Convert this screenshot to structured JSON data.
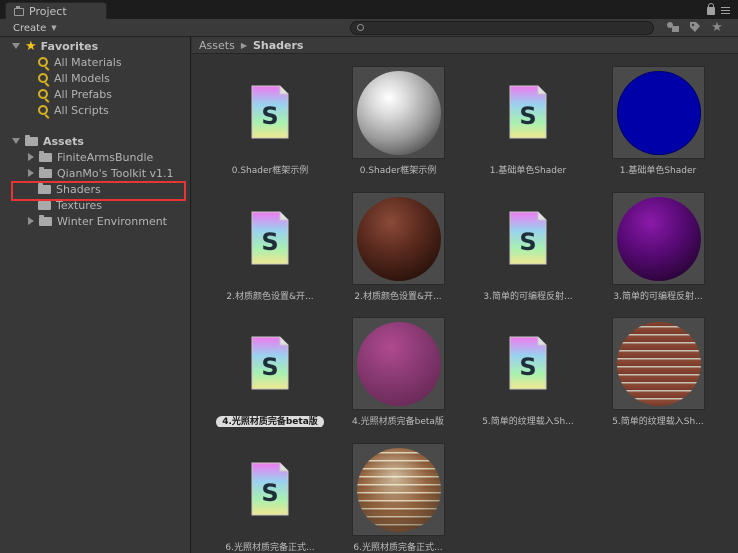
{
  "window": {
    "tab_title": "Project"
  },
  "toolbar": {
    "create_label": "Create",
    "search_placeholder": ""
  },
  "sidebar": {
    "favorites_label": "Favorites",
    "favorites": [
      "All Materials",
      "All Models",
      "All Prefabs",
      "All Scripts"
    ],
    "assets_label": "Assets",
    "folders": [
      "FiniteArmsBundle",
      "QianMo's Toolkit v1.1",
      "Shaders",
      "Textures",
      "Winter Environment"
    ],
    "selected_folder": "Shaders"
  },
  "breadcrumb": {
    "root": "Assets",
    "current": "Shaders"
  },
  "assets": [
    {
      "label": "0.Shader框架示例",
      "kind": "shader"
    },
    {
      "label": "0.Shader框架示例",
      "kind": "material",
      "preview": "white-gloss"
    },
    {
      "label": "1.基础单色Shader",
      "kind": "shader"
    },
    {
      "label": "1.基础单色Shader",
      "kind": "material",
      "preview": "blue-flat"
    },
    {
      "label": "2.材质颜色设置&开...",
      "kind": "shader"
    },
    {
      "label": "2.材质颜色设置&开...",
      "kind": "material",
      "preview": "brown-lit"
    },
    {
      "label": "3.简单的可编程反射...",
      "kind": "shader"
    },
    {
      "label": "3.简单的可编程反射...",
      "kind": "material",
      "preview": "purple-lit"
    },
    {
      "label": "4.光照材质完备beta版",
      "kind": "shader",
      "selected": true
    },
    {
      "label": "4.光照材质完备beta版",
      "kind": "material",
      "preview": "pink-lit"
    },
    {
      "label": "5.简单的纹理载入Sh...",
      "kind": "shader"
    },
    {
      "label": "5.简单的纹理载入Sh...",
      "kind": "material",
      "preview": "brick"
    },
    {
      "label": "6.光照材质完备正式...",
      "kind": "shader"
    },
    {
      "label": "6.光照材质完备正式...",
      "kind": "material",
      "preview": "brick-lit"
    }
  ],
  "icons": {
    "shader_glyph": "S",
    "highlight_color": "#e53535",
    "star_color": "#f2c41a"
  }
}
